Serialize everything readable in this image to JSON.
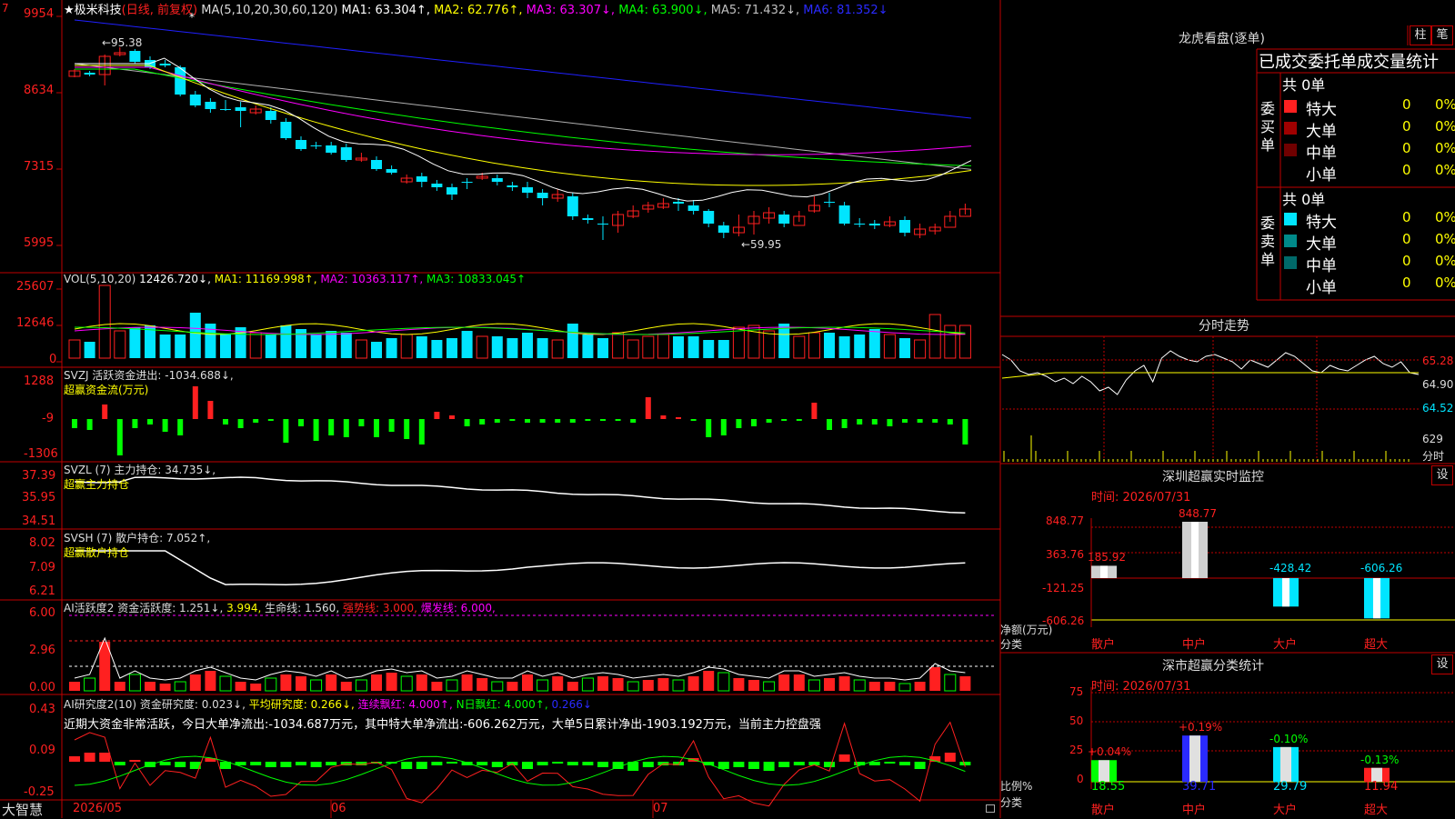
{
  "colors": {
    "up": "#ff2020",
    "down": "#00e5ff",
    "grid": "#c00000",
    "white": "#ffffff",
    "yellow": "#ffff00",
    "magenta": "#ff00ff",
    "green": "#00ff00",
    "blue": "#2020ff",
    "gray": "#b0b0b0"
  },
  "header": {
    "star": "★",
    "stock": "极米科技",
    "mode": "(日线, 前复权)",
    "ma_label": "MA(5,10,20,30,60,120)",
    "ma1": "MA1: 63.304↑,",
    "ma2": "MA2: 62.776↑,",
    "ma3": "MA3: 63.307↓,",
    "ma4": "MA4: 63.900↓,",
    "ma5": "MA5: 71.432↓,",
    "ma6": "MA6: 81.352↓"
  },
  "price_axis": {
    "labels": [
      "9954",
      "8634",
      "7315",
      "5995"
    ],
    "top_marker": "7"
  },
  "price_annotations": {
    "high": "←95.38",
    "low": "←59.95",
    "marker": "*"
  },
  "vol": {
    "title": "VOL(5,10,20)",
    "val": "12426.720↓,",
    "ma1": "MA1: 11169.998↑,",
    "ma2": "MA2: 10363.117↑,",
    "ma3": "MA3: 10833.045↑",
    "axis": [
      "25607",
      "12646",
      "0"
    ]
  },
  "svzj": {
    "title": "SVZJ  活跃资金进出: -1034.688↓,",
    "sub": "超赢资金流(万元)",
    "axis": [
      "1288",
      "-9",
      "-1306"
    ]
  },
  "svzl": {
    "title": "SVZL (7) 主力持仓: 34.735↓,",
    "sub": "超赢主力持仓",
    "axis": [
      "37.39",
      "35.95",
      "34.51"
    ]
  },
  "svsh": {
    "title": "SVSH (7) 散户持仓: 7.052↑,",
    "sub": "超赢散户持仓",
    "axis": [
      "8.02",
      "7.09",
      "6.21"
    ]
  },
  "ai1": {
    "title": "AI活跃度2 资金活跃度: 1.251↓,",
    "v2": "3.994,",
    "v3": "生命线: 1.560,",
    "v4": "强势线: 3.000,",
    "v5": "爆发线: 6.000,",
    "axis": [
      "6.00",
      "2.96",
      "0.00"
    ]
  },
  "ai2": {
    "title": "AI研究度2(10) 资金研究度: 0.023↓,",
    "v2": "平均研究度: 0.266↓,",
    "v3": "连续飘红: 4.000↑,",
    "v4": "N日飘红: 4.000↑,",
    "v5": "0.266↓",
    "note": "近期大资金非常活跃，今日大单净流出:-1034.687万元，其中特大单净流出:-606.262万元，大单5日累计净出-1903.192万元，当前主力控盘强",
    "axis": [
      "0.43",
      "0.09",
      "-0.25"
    ]
  },
  "dates": [
    "2026/05",
    "06",
    "07"
  ],
  "brand": "大智慧",
  "right": {
    "lhb_title": "龙虎看盘(逐单)",
    "btn1": "柱",
    "btn2": "笔",
    "stat_title": "已成交委托单成交量统计",
    "buy": {
      "count": "共 0单",
      "label": "委买单",
      "rows": [
        {
          "name": "特大",
          "v": "0",
          "p": "0%"
        },
        {
          "name": "大单",
          "v": "0",
          "p": "0%"
        },
        {
          "name": "中单",
          "v": "0",
          "p": "0%"
        },
        {
          "name": "小单",
          "v": "0",
          "p": "0%"
        }
      ]
    },
    "sell": {
      "count": "共 0单",
      "label": "委卖单",
      "rows": [
        {
          "name": "特大",
          "v": "0",
          "p": "0%"
        },
        {
          "name": "大单",
          "v": "0",
          "p": "0%"
        },
        {
          "name": "中单",
          "v": "0",
          "p": "0%"
        },
        {
          "name": "小单",
          "v": "0",
          "p": "0%"
        }
      ]
    },
    "fenshi_title": "分时走势",
    "fenshi_axis": [
      "65.28",
      "64.90",
      "64.52",
      "629"
    ],
    "fenshi_unit": "分时",
    "sz_title": "深圳超赢实时监控",
    "sz_btn": "设",
    "sz_time": "时间: 2026/07/31",
    "sz_axis": [
      "848.77",
      "363.76",
      "-121.25",
      "-606.26"
    ],
    "sz_bars": [
      {
        "label": "185.92",
        "cat": "散户",
        "v": 185.92
      },
      {
        "label": "848.77",
        "cat": "中户",
        "v": 848.77
      },
      {
        "label": "-428.42",
        "cat": "大户",
        "v": -428.42
      },
      {
        "label": "-606.26",
        "cat": "超大",
        "v": -606.26
      }
    ],
    "sz_ylab1": "净额(万元)",
    "sz_ylab2": "分类",
    "fl_title": "深市超赢分类统计",
    "fl_btn": "设",
    "fl_time": "时间: 2026/07/31",
    "fl_axis": [
      "75",
      "50",
      "25",
      "0"
    ],
    "fl_bars": [
      {
        "top": "+0.04%",
        "bottom": "18.55",
        "cat": "散户",
        "v": 18.55
      },
      {
        "top": "+0.19%",
        "bottom": "39.71",
        "cat": "中户",
        "v": 39.71
      },
      {
        "top": "-0.10%",
        "bottom": "29.79",
        "cat": "大户",
        "v": 29.79
      },
      {
        "top": "-0.13%",
        "bottom": "11.94",
        "cat": "超大",
        "v": 11.94
      }
    ],
    "fl_ylab1": "比例%",
    "fl_ylab2": "分类"
  }
}
